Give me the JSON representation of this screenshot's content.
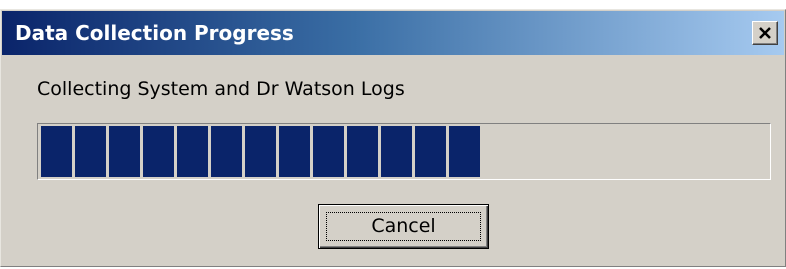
{
  "window": {
    "title": "Data Collection Progress",
    "close_icon": "close-icon"
  },
  "status": {
    "text": "Collecting System and Dr Watson Logs"
  },
  "progress": {
    "filled_blocks": 13,
    "total_blocks": 21,
    "fill_color": "#0a246a"
  },
  "buttons": {
    "cancel_label": "Cancel"
  },
  "colors": {
    "title_bar_start": "#0a246a",
    "title_bar_end": "#a6caf0",
    "dialog_face": "#d4d0c8"
  }
}
